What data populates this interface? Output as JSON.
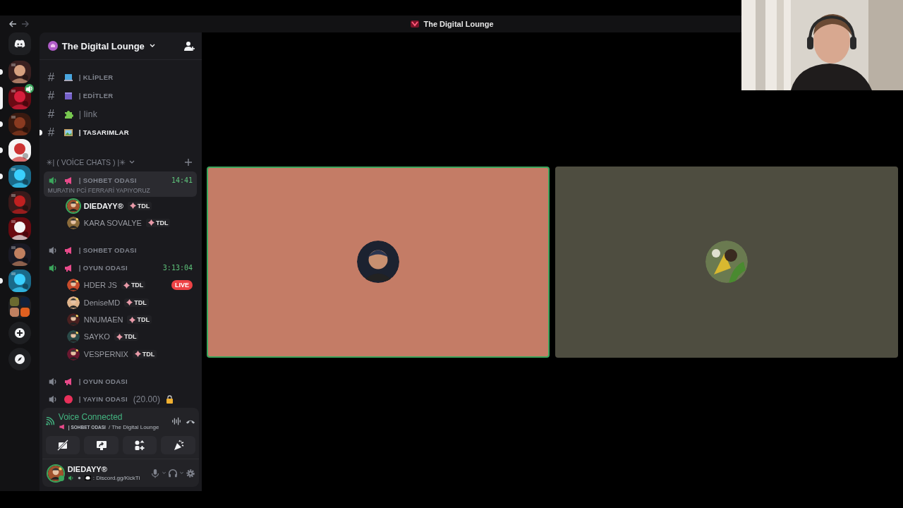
{
  "title_bar": {
    "title": "The Digital Lounge"
  },
  "servers": [
    {
      "kind": "home",
      "selected": false,
      "unread": false
    },
    {
      "kind": "server",
      "selected": false,
      "unread": true
    },
    {
      "kind": "server",
      "selected": true,
      "unread": false
    },
    {
      "kind": "server",
      "selected": false,
      "unread": true
    },
    {
      "kind": "server",
      "selected": false,
      "unread": true
    },
    {
      "kind": "server",
      "selected": false,
      "unread": true
    },
    {
      "kind": "server",
      "selected": false,
      "unread": false
    },
    {
      "kind": "server",
      "selected": false,
      "unread": false
    },
    {
      "kind": "server",
      "selected": false,
      "unread": false
    },
    {
      "kind": "server",
      "selected": false,
      "unread": true
    },
    {
      "kind": "folder",
      "selected": false,
      "unread": false
    },
    {
      "kind": "add",
      "selected": false,
      "unread": false
    },
    {
      "kind": "discover",
      "selected": false,
      "unread": false
    }
  ],
  "server_header": {
    "name": "The Digital Lounge"
  },
  "text_channels": [
    {
      "kind": "laptop",
      "hash": "#",
      "name": "| KLİPLER",
      "unread": false
    },
    {
      "kind": "clapper",
      "hash": "#",
      "name": "| EDİTLER",
      "unread": false
    },
    {
      "kind": "puzzle",
      "hash": "#",
      "name": "| link",
      "unread": false
    },
    {
      "kind": "frame",
      "hash": "#",
      "name": "| TASARIMLAR",
      "unread": true
    }
  ],
  "category": {
    "name": "✳| ( VOİCE CHATS ) |✳"
  },
  "voice_channels": [
    {
      "kind": "megaphone",
      "name": "| SOHBET ODASI",
      "active": true,
      "selected": true,
      "locked": false,
      "timer": "14:41",
      "status": "MURATIN PCİ FERRARİ YAPIYORUZ",
      "members": [
        {
          "name": "DIEDAYY®",
          "tag": "TDL",
          "speaking": true
        },
        {
          "name": "KARA SOVALYE",
          "tag": "TDL",
          "speaking": false
        }
      ]
    },
    {
      "kind": "megaphone",
      "name": "| SOHBET ODASI",
      "active": false,
      "selected": false,
      "locked": false
    },
    {
      "kind": "megaphone",
      "name": "| OYUN ODASI",
      "active": true,
      "selected": false,
      "locked": false,
      "timer": "3:13:04",
      "members": [
        {
          "name": "HDER JS",
          "tag": "TDL",
          "speaking": false,
          "badge": "LIVE"
        },
        {
          "name": "DeniseMD",
          "tag": "TDL",
          "speaking": false
        },
        {
          "name": "NNUMAEN",
          "tag": "TDL",
          "speaking": false
        },
        {
          "name": "SAYKO",
          "tag": "TDL",
          "speaking": false
        },
        {
          "name": "VESPERNIX",
          "tag": "TDL",
          "speaking": false
        }
      ]
    },
    {
      "kind": "megaphone",
      "name": "| OYUN ODASI",
      "active": false,
      "selected": false,
      "locked": false
    },
    {
      "kind": "dot",
      "name": "| YAYIN ODASI",
      "suffix": "(20.00)",
      "active": false,
      "selected": false,
      "locked": true
    }
  ],
  "voice_panel": {
    "status": "Voice Connected",
    "channel": "| SOHBET ODASI",
    "server": "/ The Digital Lounge"
  },
  "user_panel": {
    "name": "DIEDAYY®",
    "status": ": Discord.gg/KickTi"
  },
  "stage": {
    "tiles": [
      {
        "color": "#c47c66",
        "speaking": true
      },
      {
        "color": "#4e4d40",
        "speaking": false
      }
    ]
  }
}
